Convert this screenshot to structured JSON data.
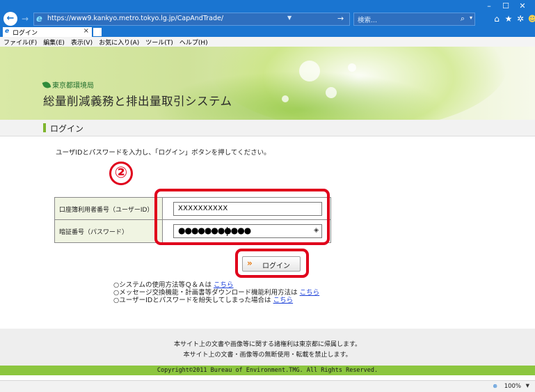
{
  "browser": {
    "address_url": "https://www9.kankyo.metro.tokyo.lg.jp/CapAndTrade/",
    "search_placeholder": "検索...",
    "tab_label": "ログイン",
    "menu": [
      "ファイル(F)",
      "編集(E)",
      "表示(V)",
      "お気に入り(A)",
      "ツール(T)",
      "ヘルプ(H)"
    ],
    "zoom_level": "100%"
  },
  "header": {
    "department": "東京都環境局",
    "system_title": "総量削減義務と排出量取引システム"
  },
  "section": {
    "title": "ログイン"
  },
  "instruction": "ユーザIDとパスワードを入力し、「ログイン」ボタンを押してください。",
  "step_badge": "②",
  "form": {
    "user_id_label": "口座簿利用者番号（ユーザーID）",
    "user_id_value": "XXXXXXXXXX",
    "password_label": "暗証番号（パスワード）",
    "password_value": "●●●●●●●●●●●"
  },
  "login_button": {
    "arrows": "»",
    "label": "ログイン"
  },
  "help": [
    {
      "text": "○システムの使用方法等Ｑ＆Ａは",
      "link": "こちら"
    },
    {
      "text": "○メッセージ交換機能・計画書等ダウンロード機能利用方法は",
      "link": "こちら"
    },
    {
      "text": "○ユーザーIDとパスワードを紛失してしまった場合は",
      "link": "こちら"
    }
  ],
  "footer": {
    "line1": "本サイト上の文書や画像等に関する諸権利は東京都に帰属します。",
    "line2": "本サイト上の文書・画像等の無断使用・転載を禁止します。",
    "copyright": "Copyright©2011 Bureau of Environment.TMG. All Rights Reserved."
  },
  "colors": {
    "accent_green": "#8cc63f",
    "highlight_red": "#e0001b",
    "chrome_blue": "#1a75d1"
  }
}
